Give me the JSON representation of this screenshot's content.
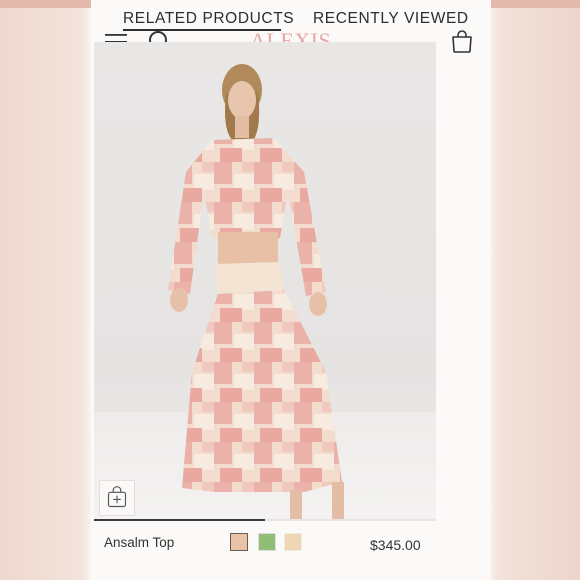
{
  "tabs": {
    "related": "RELATED PRODUCTS",
    "recently_viewed": "RECENTLY VIEWED",
    "active": "related"
  },
  "header": {
    "menu_icon": "hamburger-menu-icon",
    "search_icon": "search-icon",
    "logo": "ALEXIS",
    "bag_icon": "shopping-bag-icon"
  },
  "product": {
    "image_alt": "model wearing pink patchwork cropped wrap top and midi skirt",
    "add_icon": "add-to-bag-icon",
    "gallery_progress": 0.5,
    "name": "Ansalm Top",
    "price": "$345.00",
    "swatches": [
      {
        "name": "blush-swatch",
        "color": "#eac3a7",
        "selected": true
      },
      {
        "name": "green-swatch",
        "color": "#8fbf75",
        "selected": false
      },
      {
        "name": "cream-swatch",
        "color": "#f0d7b4",
        "selected": false
      }
    ]
  },
  "colors": {
    "logo": "#e7a7a7",
    "text": "#2d2d2d",
    "background": "#fcfaf8"
  }
}
